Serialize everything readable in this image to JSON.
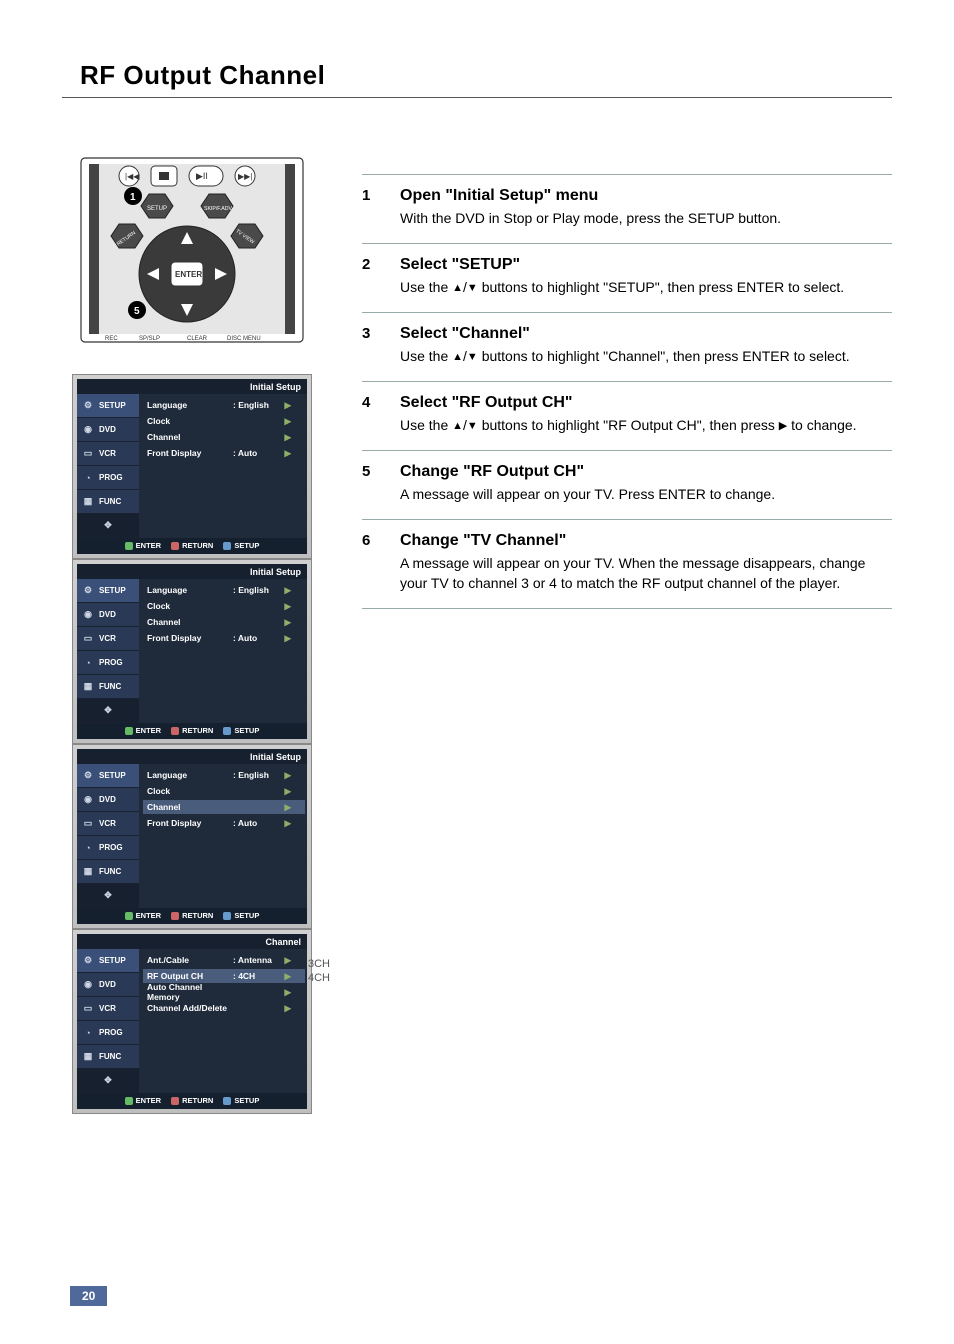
{
  "page": {
    "title": "RF Output Channel",
    "number": "20"
  },
  "remote": {
    "button_setup": "SETUP",
    "button_skip": "SKIP/F.ADV",
    "button_return": "RETURN",
    "button_tvview": "TV VIEW",
    "button_enter": "ENTER",
    "label_rec": "REC",
    "label_spslp": "SP/SLP",
    "label_clear": "CLEAR",
    "label_discmenu": "DISC MENU",
    "marker1": "1",
    "marker5": "5"
  },
  "osd_common": {
    "tabs": [
      "SETUP",
      "DVD",
      "VCR",
      "PROG",
      "FUNC"
    ],
    "footer": {
      "enter": "ENTER",
      "return": "RETURN",
      "setup": "SETUP"
    },
    "move_icon": "move-icon"
  },
  "osd_panels": [
    {
      "header": "Initial Setup",
      "selected_tab": 0,
      "highlight_row": null,
      "highlight_third_tab": false,
      "rows": [
        {
          "label": "Language",
          "value": ": English",
          "arrow": "▶"
        },
        {
          "label": "Clock",
          "value": "",
          "arrow": "▶"
        },
        {
          "label": "Channel",
          "value": "",
          "arrow": "▶"
        },
        {
          "label": "Front Display",
          "value": ": Auto",
          "arrow": "▶"
        }
      ]
    },
    {
      "header": "Initial Setup",
      "selected_tab": 0,
      "highlight_row": null,
      "highlight_third_tab": false,
      "rows": [
        {
          "label": "Language",
          "value": ": English",
          "arrow": "▶"
        },
        {
          "label": "Clock",
          "value": "",
          "arrow": "▶"
        },
        {
          "label": "Channel",
          "value": "",
          "arrow": "▶"
        },
        {
          "label": "Front Display",
          "value": ": Auto",
          "arrow": "▶"
        }
      ]
    },
    {
      "header": "Initial Setup",
      "selected_tab": 0,
      "highlight_row": 2,
      "highlight_third_tab": false,
      "rows": [
        {
          "label": "Language",
          "value": ": English",
          "arrow": "▶"
        },
        {
          "label": "Clock",
          "value": "",
          "arrow": "▶"
        },
        {
          "label": "Channel",
          "value": "",
          "arrow": "▶"
        },
        {
          "label": "Front Display",
          "value": ": Auto",
          "arrow": "▶"
        }
      ]
    },
    {
      "header": "Channel",
      "selected_tab": 0,
      "highlight_row": 1,
      "highlight_third_tab": false,
      "rows": [
        {
          "label": "Ant./Cable",
          "value": ": Antenna",
          "arrow": "▶"
        },
        {
          "label": "RF Output CH",
          "value": ": 4CH",
          "arrow": "▶"
        },
        {
          "label": "Auto Channel Memory",
          "value": "",
          "arrow": "▶"
        },
        {
          "label": "Channel Add/Delete",
          "value": "",
          "arrow": "▶"
        }
      ],
      "side_options": [
        "3CH",
        "4CH"
      ]
    }
  ],
  "steps": [
    {
      "num": "1",
      "heading": "Open \"Initial Setup\" menu",
      "body": "With the DVD in Stop or Play mode, press the SETUP button."
    },
    {
      "num": "2",
      "heading": "Select \"SETUP\"",
      "body": "Use the ▲/▼ buttons to highlight \"SETUP\", then press ENTER to select."
    },
    {
      "num": "3",
      "heading": "Select \"Channel\"",
      "body": "Use the ▲/▼ buttons to highlight \"Channel\", then press ENTER to select."
    },
    {
      "num": "4",
      "heading": "Select \"RF Output CH\"",
      "body": "Use the ▲/▼ buttons to highlight \"RF Output CH\", then press ▶ to change."
    },
    {
      "num": "5",
      "heading": "Change \"RF Output CH\"",
      "body": "A message will appear on your TV. Press ENTER to change."
    },
    {
      "num": "6",
      "heading": "Change \"TV Channel\"",
      "body": "A message will appear on your TV. When the message disappears, change your TV to channel 3 or 4 to match the RF output channel of the player."
    }
  ]
}
